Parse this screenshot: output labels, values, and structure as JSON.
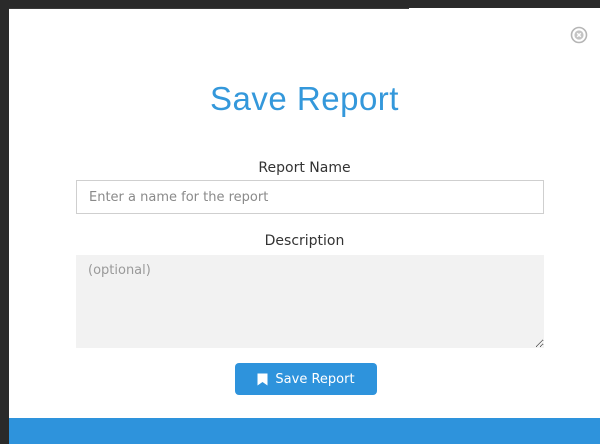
{
  "modal": {
    "title": "Save Report",
    "close_icon": "close-circle-icon",
    "report_name": {
      "label": "Report Name",
      "placeholder": "Enter a name for the report",
      "value": ""
    },
    "description": {
      "label": "Description",
      "placeholder": "(optional)",
      "value": ""
    },
    "save_button": {
      "label": "Save Report",
      "icon": "bookmark-icon"
    }
  },
  "colors": {
    "accent": "#2e93dc",
    "title": "#3498db",
    "textarea_bg": "#f2f2f2"
  }
}
